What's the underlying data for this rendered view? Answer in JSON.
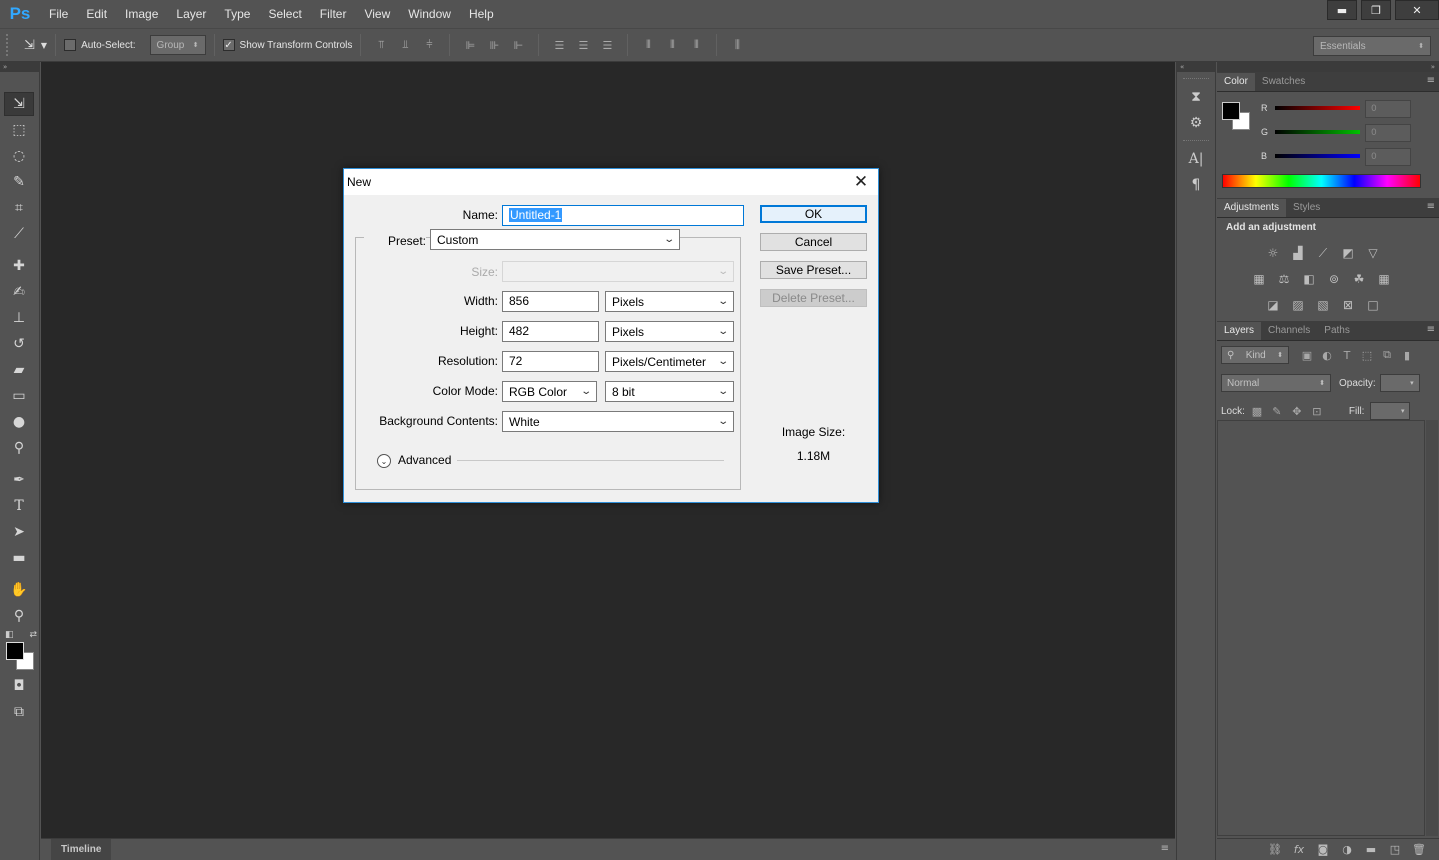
{
  "app": {
    "logo": "Ps",
    "menu": [
      "File",
      "Edit",
      "Image",
      "Layer",
      "Type",
      "Select",
      "Filter",
      "View",
      "Window",
      "Help"
    ],
    "window_controls": {
      "minimize": "▬",
      "restore": "❐",
      "close": "✕"
    }
  },
  "options_bar": {
    "auto_select_label": "Auto-Select:",
    "auto_select_checked": false,
    "auto_select_target": "Group",
    "show_transform_label": "Show Transform Controls",
    "show_transform_checked": true,
    "workspace": "Essentials"
  },
  "timeline": {
    "tab_label": "Timeline"
  },
  "panels": {
    "color": {
      "tabs": [
        "Color",
        "Swatches"
      ],
      "channels": [
        {
          "letter": "R",
          "value": "0",
          "color": "#ff0000"
        },
        {
          "letter": "G",
          "value": "0",
          "color": "#00c000"
        },
        {
          "letter": "B",
          "value": "0",
          "color": "#0000ff"
        }
      ]
    },
    "adjustments": {
      "tabs": [
        "Adjustments",
        "Styles"
      ],
      "title": "Add an adjustment"
    },
    "layers": {
      "tabs": [
        "Layers",
        "Channels",
        "Paths"
      ],
      "filter_kind": "Kind",
      "blend_mode": "Normal",
      "opacity_label": "Opacity:",
      "lock_label": "Lock:",
      "fill_label": "Fill:"
    }
  },
  "dialog": {
    "title": "New",
    "name_label": "Name:",
    "name_value": "Untitled-1",
    "preset_label": "Preset:",
    "preset_value": "Custom",
    "size_label": "Size:",
    "width_label": "Width:",
    "width_value": "856",
    "width_unit": "Pixels",
    "height_label": "Height:",
    "height_value": "482",
    "height_unit": "Pixels",
    "resolution_label": "Resolution:",
    "resolution_value": "72",
    "resolution_unit": "Pixels/Centimeter",
    "color_mode_label": "Color Mode:",
    "color_mode_value": "RGB Color",
    "bit_depth_value": "8 bit",
    "background_label": "Background Contents:",
    "background_value": "White",
    "advanced_label": "Advanced",
    "image_size_label": "Image Size:",
    "image_size_value": "1.18M",
    "buttons": {
      "ok": "OK",
      "cancel": "Cancel",
      "save_preset": "Save Preset...",
      "delete_preset": "Delete Preset..."
    }
  }
}
